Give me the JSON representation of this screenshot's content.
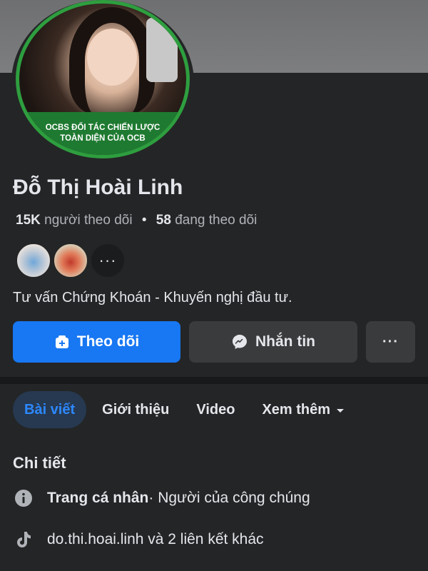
{
  "profile": {
    "name": "Đỗ Thị Hoài Linh",
    "followers_count": "15K",
    "followers_label": "người theo dõi",
    "separator": "•",
    "following_count": "58",
    "following_label": "đang theo dõi",
    "bio": "Tư vấn Chứng Khoán - Khuyến nghị đầu tư.",
    "avatar_badge_line1": "OCBS ĐỐI TÁC CHIẾN LƯỢC",
    "avatar_badge_line2": "TOÀN DIỆN CỦA OCB",
    "friends_more": "···"
  },
  "actions": {
    "follow_label": "Theo dõi",
    "message_label": "Nhắn tin",
    "more_label": "···"
  },
  "tabs": [
    {
      "label": "Bài viết",
      "active": true
    },
    {
      "label": "Giới thiệu",
      "active": false
    },
    {
      "label": "Video",
      "active": false
    },
    {
      "label": "Xem thêm",
      "active": false
    }
  ],
  "details": {
    "title": "Chi tiết",
    "page_type_bold": "Trang cá nhân",
    "page_type_rest": " · Người của công chúng",
    "links_text": "do.thi.hoai.linh và 2 liên kết khác"
  },
  "colors": {
    "accent": "#1877f2",
    "active_tab_bg": "#263951",
    "active_tab_text": "#2d88ff",
    "background": "#242526",
    "badge_green": "#1f7a31"
  },
  "icons": {
    "follow": "follow-icon",
    "message": "messenger-icon",
    "more": "more-icon",
    "caret": "caret-down-icon",
    "info": "info-icon",
    "tiktok": "tiktok-icon"
  }
}
